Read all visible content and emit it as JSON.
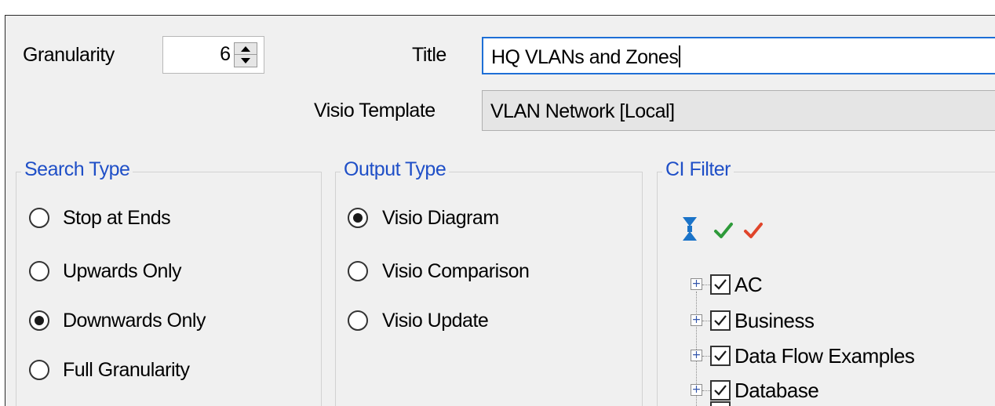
{
  "granularity": {
    "label": "Granularity",
    "value": "6"
  },
  "title_field": {
    "label": "Title",
    "value": "HQ VLANs and Zones"
  },
  "template_field": {
    "label": "Visio Template",
    "value": "VLAN Network [Local]"
  },
  "search_type": {
    "title": "Search Type",
    "options": [
      {
        "label": "Stop at Ends",
        "selected": false
      },
      {
        "label": "Upwards Only",
        "selected": false
      },
      {
        "label": "Downwards Only",
        "selected": true
      },
      {
        "label": "Full Granularity",
        "selected": false
      }
    ]
  },
  "output_type": {
    "title": "Output Type",
    "options": [
      {
        "label": "Visio Diagram",
        "selected": true
      },
      {
        "label": "Visio Comparison",
        "selected": false
      },
      {
        "label": "Visio Update",
        "selected": false
      }
    ]
  },
  "ci_filter": {
    "title": "CI Filter",
    "toolbar_icons": [
      "expand-collapse-icon",
      "check-all-icon",
      "uncheck-all-icon"
    ],
    "items": [
      {
        "label": "AC",
        "checked": true
      },
      {
        "label": "Business",
        "checked": true
      },
      {
        "label": "Data Flow Examples",
        "checked": true
      },
      {
        "label": "Database",
        "checked": true
      }
    ]
  },
  "colors": {
    "accent": "#1f4fc7",
    "focus_border": "#1e6fd6",
    "check_green": "#2e9a3a",
    "check_red": "#e0452b",
    "expand_blue": "#1a73c8"
  }
}
